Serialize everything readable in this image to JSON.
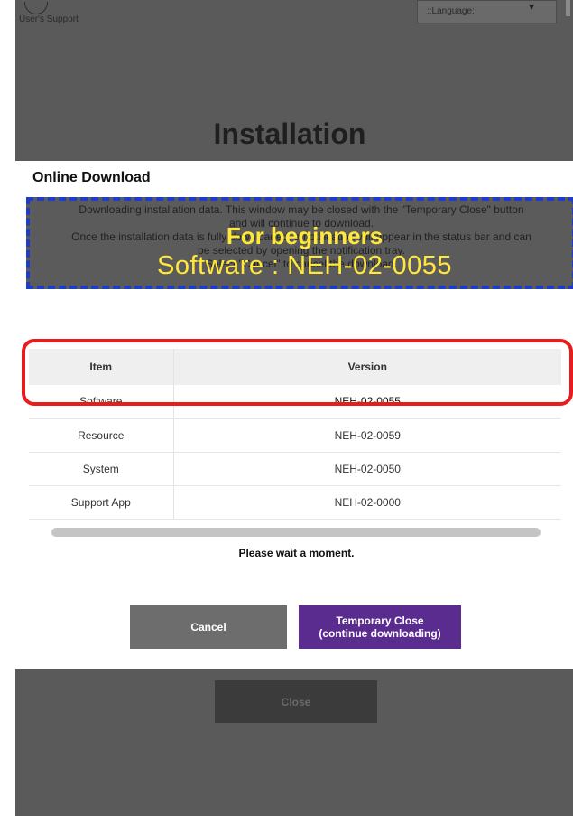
{
  "header": {
    "support_label": "User's Support",
    "language_value": "::Language::",
    "page_title": "Installation"
  },
  "dialog": {
    "title": "Online Download",
    "notice_lines": [
      "Downloading installation data. This window may be closed with the \"Temporary Close\" button",
      "and will continue to download.",
      "Once the installation data is fully downloaded, a notification will appear in the status bar and can",
      "be selected by opening the notification tray.",
      "Select \"Cancel\" to cancel the download."
    ],
    "overlay_title": "For beginners",
    "overlay_subtitle": "Software : NEH-02-0055",
    "table": {
      "headers": [
        "Item",
        "Version"
      ],
      "rows": [
        {
          "item": "Software",
          "version": "NEH-02-0055"
        },
        {
          "item": "Resource",
          "version": "NEH-02-0059"
        },
        {
          "item": "System",
          "version": "NEH-02-0050"
        },
        {
          "item": "Support App",
          "version": "NEH-02-0000"
        }
      ]
    },
    "progress_fraction": 1.0,
    "wait_message": "Please wait a moment.",
    "cancel_label": "Cancel",
    "temp_close_line1": "Temporary Close",
    "temp_close_line2": "(continue downloading)"
  },
  "footer": {
    "close_label": "Close"
  },
  "colors": {
    "accent_purple": "#5b2c8f",
    "highlight_red": "#ea1b1b",
    "overlay_blue": "#1e3ccc",
    "overlay_text": "#ffe83a"
  }
}
